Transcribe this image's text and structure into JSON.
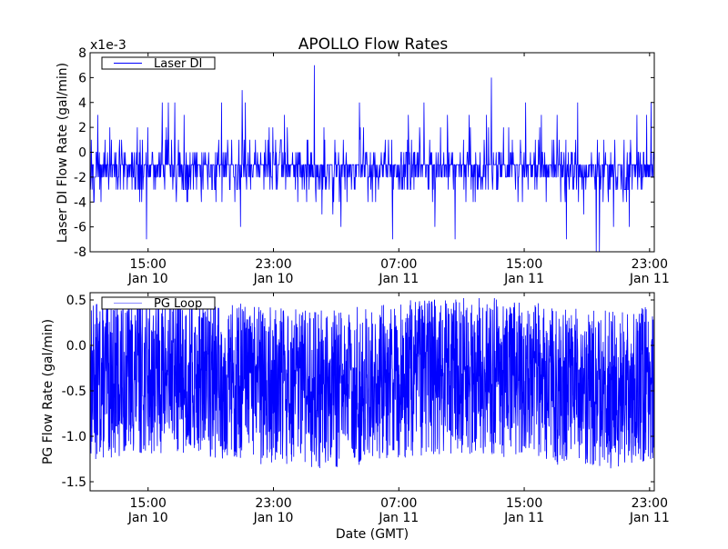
{
  "chart_data": [
    {
      "type": "line",
      "title": "APOLLO Flow Rates",
      "ylabel": "Laser DI Flow Rate (gal/min)",
      "xlabel": "",
      "scale_label": "x1e-3",
      "ylim": [
        -8,
        8
      ],
      "yticks": [
        8,
        6,
        4,
        2,
        0,
        -2,
        -4,
        -6,
        -8
      ],
      "ytick_labels": [
        "8",
        "6",
        "4",
        "2",
        "0",
        "-2",
        "-4",
        "-6",
        "-8"
      ],
      "xlim_hours": [
        0,
        36.0
      ],
      "x_start": "Jan 10 11:18",
      "xticks_hours": [
        3.7,
        11.7,
        19.7,
        27.7,
        35.7
      ],
      "xtick_labels": [
        [
          "15:00",
          "Jan 10"
        ],
        [
          "23:00",
          "Jan 10"
        ],
        [
          "07:00",
          "Jan 11"
        ],
        [
          "15:00",
          "Jan 11"
        ],
        [
          "23:00",
          "Jan 11"
        ]
      ],
      "legend": {
        "entries": [
          "Laser DI"
        ],
        "placement": "upper-left"
      },
      "series": [
        {
          "name": "Laser DI",
          "color": "#0000ff",
          "quantization": 1,
          "typical_range": [
            -3,
            1
          ],
          "baseline": -1,
          "n_points": 1400,
          "seed": 7,
          "spikes": [
            [
              0.5,
              3
            ],
            [
              3.6,
              -7
            ],
            [
              4.6,
              4
            ],
            [
              5.0,
              4
            ],
            [
              5.4,
              4
            ],
            [
              6.0,
              3
            ],
            [
              8.4,
              4
            ],
            [
              9.6,
              -6
            ],
            [
              9.7,
              5
            ],
            [
              9.9,
              4
            ],
            [
              12.4,
              3
            ],
            [
              14.3,
              7
            ],
            [
              14.8,
              -5
            ],
            [
              15.5,
              -5
            ],
            [
              16.0,
              -6
            ],
            [
              17.2,
              4
            ],
            [
              19.3,
              -7
            ],
            [
              20.3,
              3
            ],
            [
              21.3,
              4
            ],
            [
              22.0,
              -6
            ],
            [
              22.8,
              3
            ],
            [
              23.3,
              -7
            ],
            [
              24.2,
              3
            ],
            [
              25.3,
              3
            ],
            [
              25.6,
              6
            ],
            [
              27.8,
              4
            ],
            [
              28.8,
              3
            ],
            [
              29.8,
              3
            ],
            [
              30.4,
              -7
            ],
            [
              31.1,
              4
            ],
            [
              31.5,
              -5
            ],
            [
              32.3,
              -8
            ],
            [
              32.5,
              -8
            ],
            [
              33.4,
              -6
            ],
            [
              34.4,
              -6
            ],
            [
              34.9,
              3
            ],
            [
              35.5,
              3
            ],
            [
              35.8,
              4
            ]
          ]
        }
      ]
    },
    {
      "type": "line",
      "title": "",
      "ylabel": "PG Flow Rate (gal/min)",
      "xlabel": "Date (GMT)",
      "ylim": [
        -1.6,
        0.58
      ],
      "yticks": [
        0.5,
        0.0,
        -0.5,
        -1.0,
        -1.5
      ],
      "ytick_labels": [
        "0.5",
        "0.0",
        "-0.5",
        "-1.0",
        "-1.5"
      ],
      "xlim_hours": [
        0,
        36.0
      ],
      "xticks_hours": [
        3.7,
        11.7,
        19.7,
        27.7,
        35.7
      ],
      "xtick_labels": [
        [
          "15:00",
          "Jan 10"
        ],
        [
          "23:00",
          "Jan 10"
        ],
        [
          "07:00",
          "Jan 11"
        ],
        [
          "15:00",
          "Jan 11"
        ],
        [
          "23:00",
          "Jan 11"
        ]
      ],
      "legend": {
        "entries": [
          "PG Loop"
        ],
        "placement": "upper-left"
      },
      "series": [
        {
          "name": "PG Loop",
          "color": "#0000ff",
          "typical_range": [
            -1.3,
            0.5
          ],
          "min": -1.4,
          "max": 0.52,
          "n_points": 2500,
          "seed": 13
        }
      ]
    }
  ]
}
